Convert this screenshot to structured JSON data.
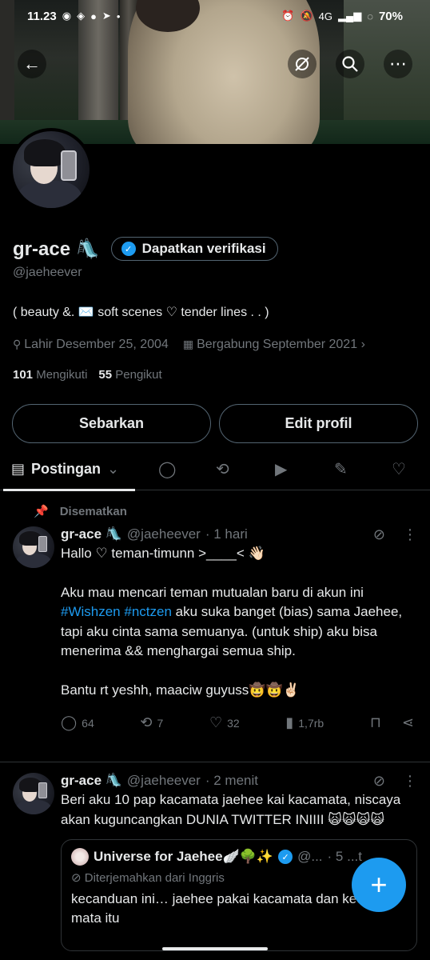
{
  "status": {
    "time": "11.23",
    "network": "4G",
    "battery": "70%"
  },
  "profile": {
    "name": "gr-ace",
    "name_emoji": "🛝",
    "verify_label": "Dapatkan verifikasi",
    "handle": "@jaeheever",
    "bio": "( beauty &. ✉️ soft scenes ♡ tender lines . . )",
    "birth": "Lahir Desember 25, 2004",
    "joined": "Bergabung September 2021",
    "following_count": "101",
    "following_label": "Mengikuti",
    "followers_count": "55",
    "followers_label": "Pengikut"
  },
  "buttons": {
    "share": "Sebarkan",
    "edit": "Edit profil"
  },
  "tabs": {
    "active": "Postingan"
  },
  "pinned_label": "Disematkan",
  "tweet1": {
    "name": "gr-ace 🛝",
    "handle": "@jaeheever",
    "time": "· 1 hari",
    "line1": "Hallo ♡ teman-timunn >____< 👋🏻",
    "line2_pre": "Aku mau mencari teman mutualan baru di akun ini",
    "hashtags": "#Wishzen #nctzen",
    "line2_post": "aku suka banget (bias) sama Jaehee, tapi aku cinta sama semuanya. (untuk ship) aku bisa menerima && menghargai semua ship.",
    "line3": "Bantu rt yeshh, maaciw guyuss🤠🤠✌🏻",
    "replies": "64",
    "retweets": "7",
    "likes": "32",
    "views": "1,7rb"
  },
  "tweet2": {
    "name": "gr-ace 🛝",
    "handle": "@jaeheever",
    "time": "· 2 menit",
    "text": "Beri aku 10 pap kacamata jaehee kai kacamata, niscaya akan kuguncangkan DUNIA TWITTER INIIII 🙀🙀🙀🙀",
    "quote": {
      "name": "Universe for Jaehee🪽🌳✨",
      "handle": "@...",
      "time": "· 5 ...t",
      "translated": "Diterjemahkan dari Inggris",
      "text": "kecanduan ini… jaehee pakai kacamata dan kedipan mata itu"
    }
  }
}
